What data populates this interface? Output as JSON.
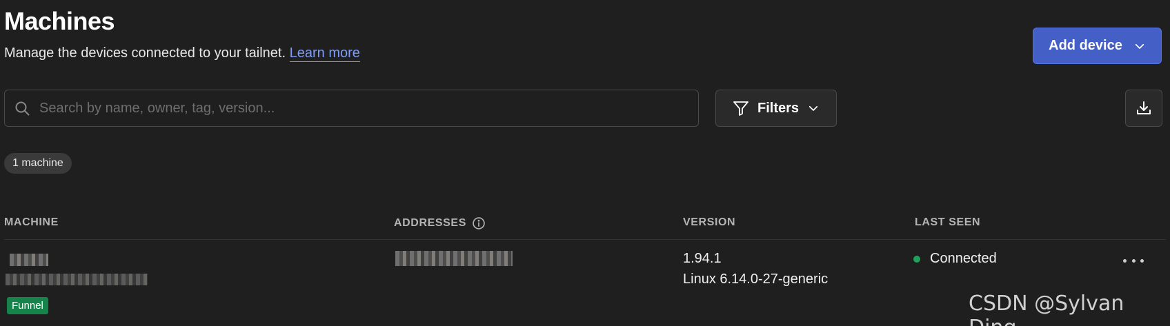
{
  "header": {
    "title": "Machines",
    "subtitle": "Manage the devices connected to your tailnet.",
    "learn_more": "Learn more",
    "add_device_label": "Add device"
  },
  "toolbar": {
    "search_placeholder": "Search by name, owner, tag, version...",
    "filters_label": "Filters"
  },
  "count_label": "1 machine",
  "table": {
    "columns": [
      "MACHINE",
      "ADDRESSES",
      "VERSION",
      "LAST SEEN"
    ],
    "rows": [
      {
        "tag": "Funnel",
        "version": "1.94.1",
        "os": "Linux 6.14.0-27-generic",
        "status": "Connected"
      }
    ]
  },
  "watermark": "CSDN @Sylvan Ding",
  "colors": {
    "background": "#1f1f1f",
    "accent": "#4460c7",
    "link": "#7d9cf7",
    "connected": "#1fa35c",
    "funnel_badge": "#16844a"
  }
}
